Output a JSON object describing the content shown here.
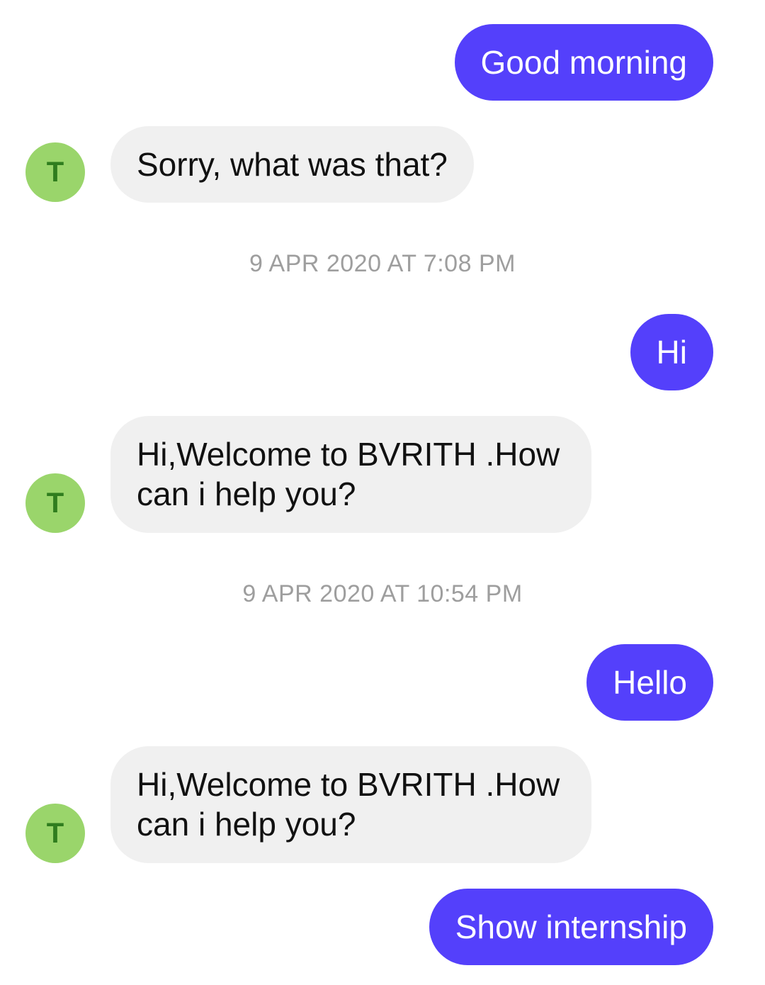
{
  "theme": {
    "outgoing_bubble_color": "#5440fb",
    "incoming_bubble_color": "#f0f0f0",
    "avatar_color": "#9ad56b",
    "avatar_text_color": "#2f7d1e",
    "timestamp_color": "#9e9e9e"
  },
  "messages": [
    {
      "sender": "user",
      "text": "Good morning"
    },
    {
      "sender": "bot",
      "avatar": "T",
      "text": "Sorry, what was that?"
    },
    {
      "type": "timestamp",
      "text": "9 APR 2020 AT 7:08 PM"
    },
    {
      "sender": "user",
      "text": "Hi"
    },
    {
      "sender": "bot",
      "avatar": "T",
      "line1": "Hi,Welcome to BVRITH .How",
      "line2": "can i help you?"
    },
    {
      "type": "timestamp",
      "text": "9 APR 2020 AT 10:54 PM"
    },
    {
      "sender": "user",
      "text": "Hello"
    },
    {
      "sender": "bot",
      "avatar": "T",
      "line1": "Hi,Welcome to BVRITH .How",
      "line2": "can i help you?"
    },
    {
      "sender": "user",
      "text": "Show internship"
    }
  ]
}
